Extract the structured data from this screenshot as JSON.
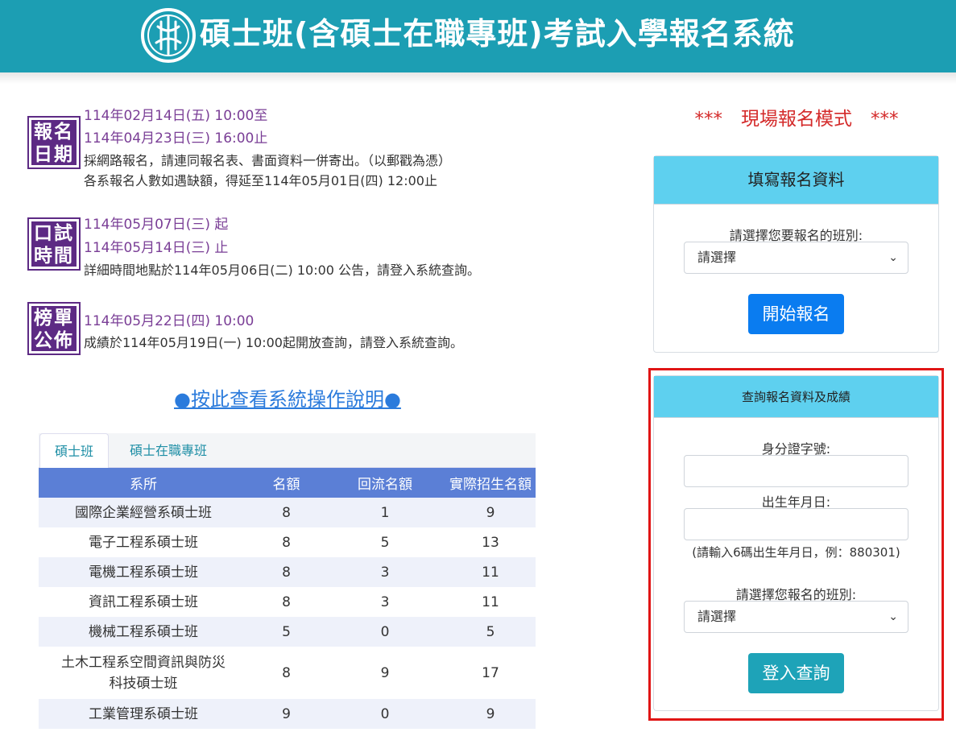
{
  "header": {
    "title": "碩士班(含碩士在職專班)考試入學報名系統",
    "logo_icon": "school-emblem-icon",
    "bg_color": "#1c9eb3"
  },
  "schedule": [
    {
      "badge_line1": "報名",
      "badge_line2": "日期",
      "lines": [
        {
          "text": "114年02月14日(五) 10:00至",
          "style": "purple"
        },
        {
          "text": "114年04月23日(三) 16:00止",
          "style": "purple"
        },
        {
          "text": "採網路報名，請連同報名表、書面資料一併寄出。（以郵戳為憑）",
          "style": "dark"
        },
        {
          "text": "各系報名人數如遇缺額，得延至114年05月01日(四) 12:00止",
          "style": "dark"
        }
      ]
    },
    {
      "badge_line1": "口試",
      "badge_line2": "時間",
      "lines": [
        {
          "text": "114年05月07日(三) 起",
          "style": "purple"
        },
        {
          "text": "114年05月14日(三) 止",
          "style": "purple"
        },
        {
          "text": "詳細時間地點於114年05月06日(二) 10:00 公告，請登入系統查詢。",
          "style": "dark"
        }
      ]
    },
    {
      "badge_line1": "榜單",
      "badge_line2": "公佈",
      "lines": [
        {
          "text": "114年05月22日(四) 10:00",
          "style": "purple"
        },
        {
          "text": "成績於114年05月19日(一) 10:00起開放查詢，請登入系統查詢。",
          "style": "dark"
        }
      ]
    }
  ],
  "guide_link": "●按此查看系統操作說明●",
  "tabs": [
    "碩士班",
    "碩士在職專班"
  ],
  "active_tab": 0,
  "table": {
    "headers": [
      "系所",
      "名額",
      "回流名額",
      "實際招生名額"
    ],
    "rows": [
      [
        "國際企業經營系碩士班",
        "8",
        "1",
        "9"
      ],
      [
        "電子工程系碩士班",
        "8",
        "5",
        "13"
      ],
      [
        "電機工程系碩士班",
        "8",
        "3",
        "11"
      ],
      [
        "資訊工程系碩士班",
        "8",
        "3",
        "11"
      ],
      [
        "機械工程系碩士班",
        "5",
        "0",
        "5"
      ],
      [
        "土木工程系空間資訊與防災\n科技碩士班",
        "8",
        "9",
        "17"
      ],
      [
        "工業管理系碩士班",
        "9",
        "0",
        "9"
      ]
    ]
  },
  "mode_label": "***　現場報名模式　***",
  "apply_card": {
    "title": "填寫報名資料",
    "class_label": "請選擇您要報名的班別:",
    "select_value": "請選擇",
    "button": "開始報名"
  },
  "query_card": {
    "title": "查詢報名資料及成績",
    "id_label": "身分證字號:",
    "id_value": "",
    "birth_label": "出生年月日:",
    "birth_value": "",
    "birth_hint": "(請輸入6碼出生年月日，例：880301)",
    "class_label": "請選擇您報名的班別:",
    "select_value": "請選擇",
    "button": "登入查詢"
  },
  "colors": {
    "accent_purple": "#5d2a84",
    "table_header": "#5b7fd6",
    "card_header": "#5ed0ef",
    "btn_primary": "#0a7cf0",
    "btn_teal": "#1ea3b8",
    "highlight_red": "#e01515"
  }
}
